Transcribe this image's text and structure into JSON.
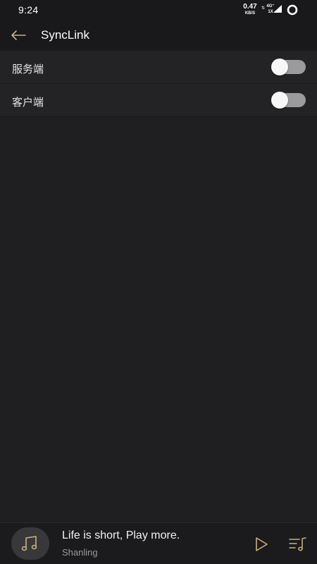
{
  "status_bar": {
    "time": "9:24",
    "net_speed_value": "0.47",
    "net_speed_unit": "KB/S",
    "net_type_top": "4G⁺",
    "net_type_bottom": "1X",
    "icons": [
      "signal-icon",
      "battery-ring-icon"
    ]
  },
  "header": {
    "title": "SyncLink",
    "back_icon": "back-arrow-icon"
  },
  "settings": {
    "items": [
      {
        "label": "服务端",
        "enabled": false
      },
      {
        "label": "客户端",
        "enabled": false
      }
    ]
  },
  "player": {
    "title": "Life is short, Play more.",
    "artist": "Shanling",
    "icons": [
      "music-note-icon",
      "play-icon",
      "playlist-icon"
    ]
  },
  "colors": {
    "accent_gold": "#c9b27a",
    "background": "#1f1e20",
    "header_bg": "#19181a",
    "row_bg": "#232224"
  }
}
